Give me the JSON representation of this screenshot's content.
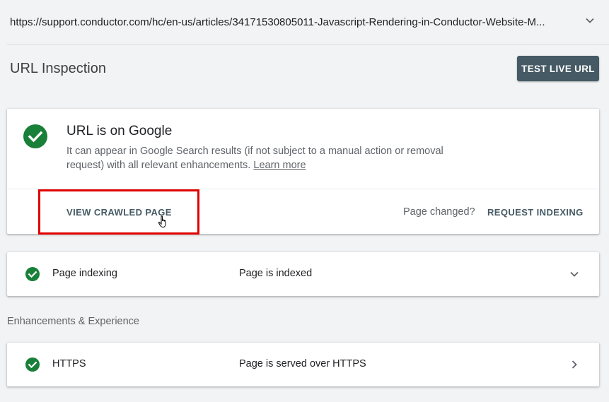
{
  "url_bar": {
    "url": "https://support.conductor.com/hc/en-us/articles/34171530805011-Javascript-Rendering-in-Conductor-Website-M...",
    "expand_icon": "chevron-down-icon"
  },
  "header": {
    "title": "URL Inspection",
    "test_live_url_label": "TEST LIVE URL"
  },
  "status_card": {
    "icon": "check-circle-icon",
    "title": "URL is on Google",
    "description": "It can appear in Google Search results (if not subject to a manual action or removal request) with all relevant enhancements.",
    "learn_more_label": "Learn more",
    "view_crawled_label": "VIEW CRAWLED PAGE",
    "page_changed_label": "Page changed?",
    "request_indexing_label": "REQUEST INDEXING"
  },
  "indexing_row": {
    "icon": "check-circle-icon",
    "label": "Page indexing",
    "value": "Page is indexed",
    "expand_icon": "chevron-down-icon"
  },
  "enhancements": {
    "heading": "Enhancements & Experience",
    "https_row": {
      "icon": "check-circle-icon",
      "label": "HTTPS",
      "value": "Page is served over HTTPS",
      "open_icon": "chevron-right-icon"
    }
  },
  "colors": {
    "success_green": "#188038",
    "button_slate": "#455a64",
    "highlight_red": "#e00000",
    "background": "#f1f3f4"
  }
}
